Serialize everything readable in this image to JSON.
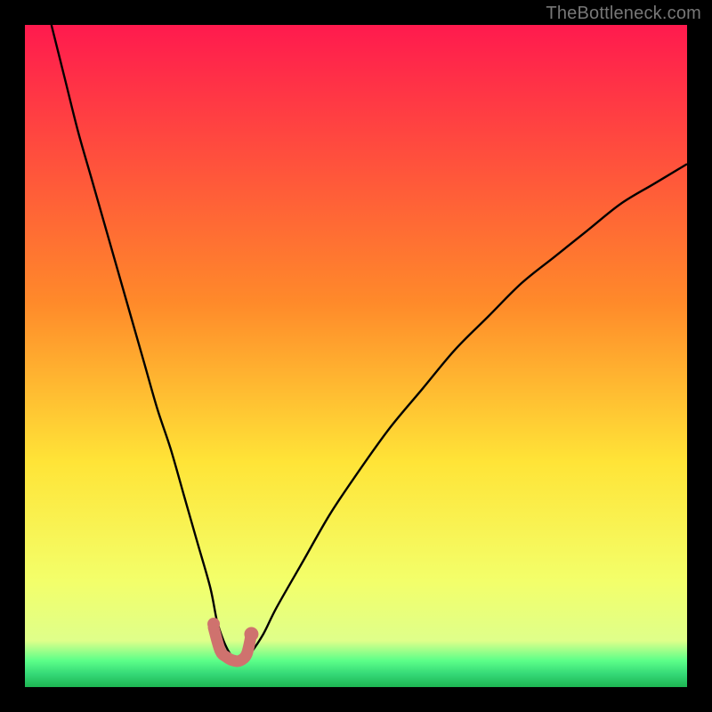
{
  "attribution": "TheBottleneck.com",
  "colors": {
    "top": "#ff1a4e",
    "mid_upper": "#ff8a2a",
    "mid": "#ffe437",
    "mid_lower": "#f3ff6a",
    "green_band": "#5cff89",
    "green_deep": "#1db552",
    "curve": "#000000",
    "marker": "#cf726e",
    "frame": "#000000"
  },
  "chart_data": {
    "type": "line",
    "title": "",
    "xlabel": "",
    "ylabel": "",
    "xlim": [
      0,
      100
    ],
    "ylim": [
      0,
      100
    ],
    "series": [
      {
        "name": "bottleneck-curve",
        "x": [
          4,
          6,
          8,
          10,
          12,
          14,
          16,
          18,
          20,
          22,
          24,
          26,
          28,
          29,
          30,
          31,
          32,
          33,
          34,
          36,
          38,
          42,
          46,
          50,
          55,
          60,
          65,
          70,
          75,
          80,
          85,
          90,
          95,
          100
        ],
        "values": [
          100,
          92,
          84,
          77,
          70,
          63,
          56,
          49,
          42,
          36,
          29,
          22,
          15,
          10,
          7,
          5,
          4,
          4,
          5,
          8,
          12,
          19,
          26,
          32,
          39,
          45,
          51,
          56,
          61,
          65,
          69,
          73,
          76,
          79
        ]
      }
    ],
    "markers": {
      "name": "optimal-range",
      "x": [
        28.5,
        29.5,
        30.5,
        31.5,
        32.5,
        33.5,
        34.2
      ],
      "values": [
        9,
        5.5,
        4.5,
        4,
        4,
        5,
        8
      ]
    },
    "axes_visible": false,
    "grid": false,
    "legend": false
  }
}
